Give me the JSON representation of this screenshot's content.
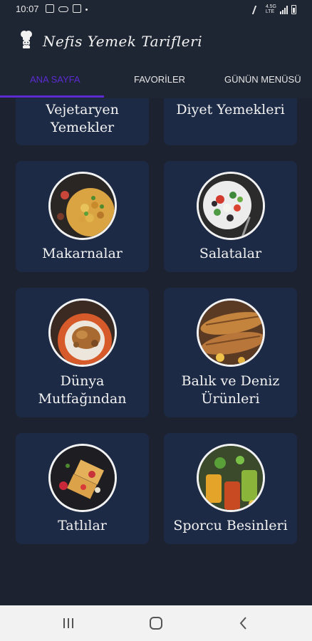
{
  "status_bar": {
    "time": "10:07",
    "network_top": "4.5G",
    "network_bottom": "LTE",
    "left_icons": [
      "image-icon",
      "voicemail-icon",
      "nfc-icon",
      "dot-icon"
    ],
    "right_icons": [
      "mute-icon",
      "signal-icon",
      "battery-icon"
    ]
  },
  "app_bar": {
    "title": "Nefis Yemek Tarifleri",
    "logo_icon": "chef-icon"
  },
  "tabs": [
    {
      "label": "ANA SAYFA",
      "active": true
    },
    {
      "label": "FAVORİLER",
      "active": false
    },
    {
      "label": "GÜNÜN MENÜSÜ",
      "active": false
    }
  ],
  "accent_color": "#5b2bd1",
  "card_color": "#1c2a45",
  "background_color": "#1c2230",
  "categories": [
    {
      "label_line1": "Vejetaryen",
      "label_line2": "Yemekler"
    },
    {
      "label_line1": "Diyet Yemekleri",
      "label_line2": ""
    },
    {
      "label_line1": "Makarnalar",
      "label_line2": "",
      "image": "pasta-bowl"
    },
    {
      "label_line1": "Salatalar",
      "label_line2": "",
      "image": "salad-bowl"
    },
    {
      "label_line1": "Dünya",
      "label_line2": "Mutfağından",
      "image": "roast-dish"
    },
    {
      "label_line1": "Balık ve Deniz",
      "label_line2": "Ürünleri",
      "image": "grilled-fish"
    },
    {
      "label_line1": "Tatlılar",
      "label_line2": "",
      "image": "waffle-dessert"
    },
    {
      "label_line1": "Sporcu Besinleri",
      "label_line2": "",
      "image": "smoothie-jars"
    }
  ],
  "nav_bar": {
    "buttons": [
      "recent-apps-icon",
      "home-icon",
      "back-icon"
    ]
  }
}
